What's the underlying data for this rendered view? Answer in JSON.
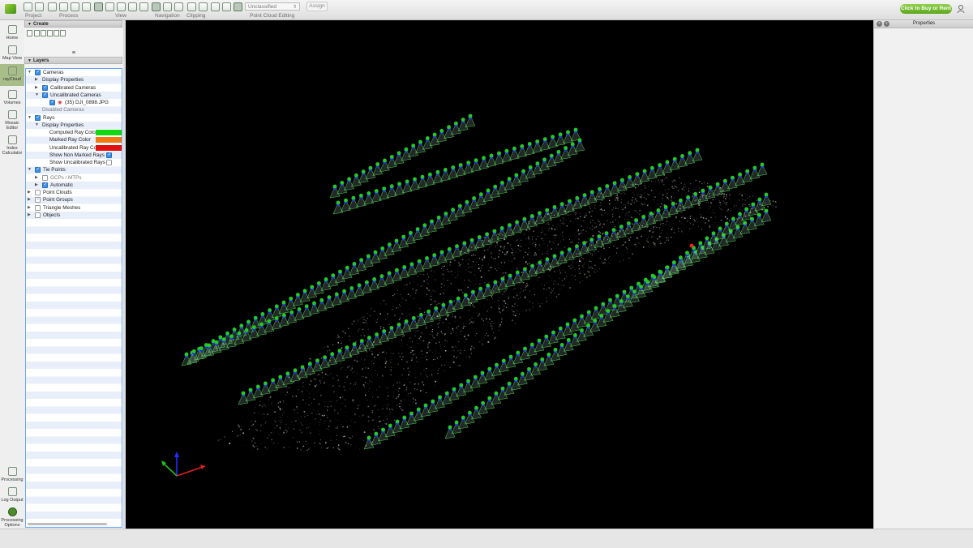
{
  "toolbar": {
    "groups": [
      "Project",
      "Process",
      "View",
      "Navigation",
      "Clipping",
      "Point Cloud Editing"
    ],
    "class_select": "Unclassified",
    "assign_label": "Assign",
    "buy_label": "Click to Buy or Rent"
  },
  "leftnav": {
    "items": [
      {
        "label": "Home",
        "icon": "home-icon"
      },
      {
        "label": "Map View",
        "icon": "map-icon"
      },
      {
        "label": "rayCloud",
        "icon": "raycloud-icon"
      },
      {
        "label": "Volumes",
        "icon": "volumes-icon"
      },
      {
        "label": "Mosaic Editor",
        "icon": "mosaic-icon"
      },
      {
        "label": "Index Calculator",
        "icon": "index-calculator-icon"
      },
      {
        "label": "Processing",
        "icon": "processing-icon"
      },
      {
        "label": "Log Output",
        "icon": "log-icon"
      },
      {
        "label": "Processing Options",
        "icon": "gear-icon"
      }
    ]
  },
  "panel": {
    "create_header": "Create",
    "layers_header": "Layers"
  },
  "tree": [
    {
      "text": "Cameras",
      "level": 0,
      "arrow": "open",
      "check": "on"
    },
    {
      "text": "Display Properties",
      "level": 1,
      "arrow": "closed",
      "check": null
    },
    {
      "text": "Calibrated Cameras",
      "level": 1,
      "arrow": "closed",
      "check": "on"
    },
    {
      "text": "Uncalibrated Cameras",
      "level": 1,
      "arrow": "open",
      "check": "on"
    },
    {
      "text": "(35) DJI_0898.JPG",
      "level": 2,
      "arrow": null,
      "check": "on",
      "icon": true
    },
    {
      "text": "Disabled Cameras",
      "level": 1,
      "arrow": null,
      "check": null,
      "muted": true
    },
    {
      "text": "Rays",
      "level": 0,
      "arrow": "open",
      "check": "on"
    },
    {
      "text": "Display Properties",
      "level": 1,
      "arrow": "open",
      "check": null
    },
    {
      "text": "Computed Ray Color",
      "level": 2,
      "arrow": null,
      "check": null,
      "swatch": "#11d811"
    },
    {
      "text": "Marked Ray Color",
      "level": 2,
      "arrow": null,
      "check": null,
      "swatch": "#f07a10"
    },
    {
      "text": "Uncalibrated Ray Color",
      "level": 2,
      "arrow": null,
      "check": null,
      "swatch": "#e01010"
    },
    {
      "text": "Show Non Marked Rays",
      "level": 2,
      "arrow": null,
      "check": null,
      "rcheck": "on"
    },
    {
      "text": "Show Uncalibrated Rays",
      "level": 2,
      "arrow": null,
      "check": null,
      "rcheck": "off"
    },
    {
      "text": "Tie Points",
      "level": 0,
      "arrow": "open",
      "check": "on"
    },
    {
      "text": "GCPs / MTPs",
      "level": 1,
      "arrow": "closed",
      "check": "off",
      "muted": true
    },
    {
      "text": "Automatic",
      "level": 1,
      "arrow": "closed",
      "check": "on"
    },
    {
      "text": "Point Clouds",
      "level": 0,
      "arrow": "closed",
      "check": "off"
    },
    {
      "text": "Point Groups",
      "level": 0,
      "arrow": "closed",
      "check": "dash"
    },
    {
      "text": "Triangle Meshes",
      "level": 0,
      "arrow": "closed",
      "check": "off"
    },
    {
      "text": "Objects",
      "level": 0,
      "arrow": "closed",
      "check": "off"
    }
  ],
  "properties": {
    "title": "Properties"
  },
  "colors": {
    "accent": "#6dbf2a",
    "camera_dot": "#22cc22",
    "camera_blue": "#2233cc",
    "frustum": "#44dd44"
  }
}
